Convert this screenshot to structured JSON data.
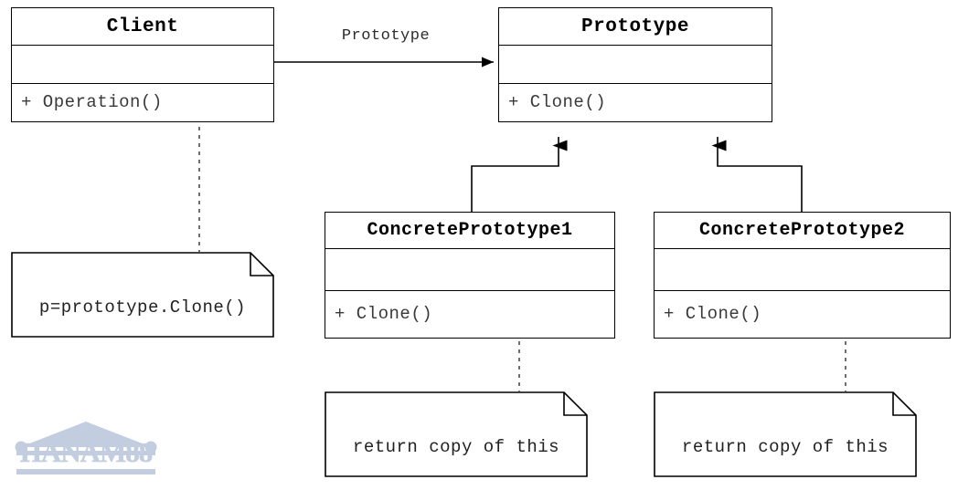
{
  "diagram": {
    "type": "uml-class-diagram",
    "pattern": "Prototype",
    "background_color": "#ffffff",
    "line_color": "#000000"
  },
  "classes": [
    {
      "id": "client",
      "name": "Client",
      "attributes": [],
      "operations": [
        "+ Operation()"
      ]
    },
    {
      "id": "prototype",
      "name": "Prototype",
      "attributes": [],
      "operations": [
        "+ Clone()"
      ]
    },
    {
      "id": "concrete1",
      "name": "ConcretePrototype1",
      "attributes": [],
      "operations": [
        "+ Clone()"
      ]
    },
    {
      "id": "concrete2",
      "name": "ConcretePrototype2",
      "attributes": [],
      "operations": [
        "+ Clone()"
      ]
    }
  ],
  "notes": [
    {
      "id": "note-client",
      "text": "p=prototype.Clone()",
      "anchored_to": "client"
    },
    {
      "id": "note-c1",
      "text": "return copy of this",
      "anchored_to": "concrete1"
    },
    {
      "id": "note-c2",
      "text": "return copy of this",
      "anchored_to": "concrete2"
    }
  ],
  "relationships": [
    {
      "id": "assoc-client-prototype",
      "kind": "association",
      "from": "Client",
      "to": "Prototype",
      "label": "Prototype",
      "arrow": "open-arrow"
    },
    {
      "id": "gen-concrete1",
      "kind": "generalization",
      "from": "ConcretePrototype1",
      "to": "Prototype",
      "label": "",
      "arrow": "solid-triangle"
    },
    {
      "id": "gen-concrete2",
      "kind": "generalization",
      "from": "ConcretePrototype2",
      "to": "Prototype",
      "label": "",
      "arrow": "solid-triangle"
    }
  ],
  "watermark": {
    "text": "HANAM88",
    "color": "#c3cde0",
    "logo_icon": "temple-pediment-icon"
  }
}
